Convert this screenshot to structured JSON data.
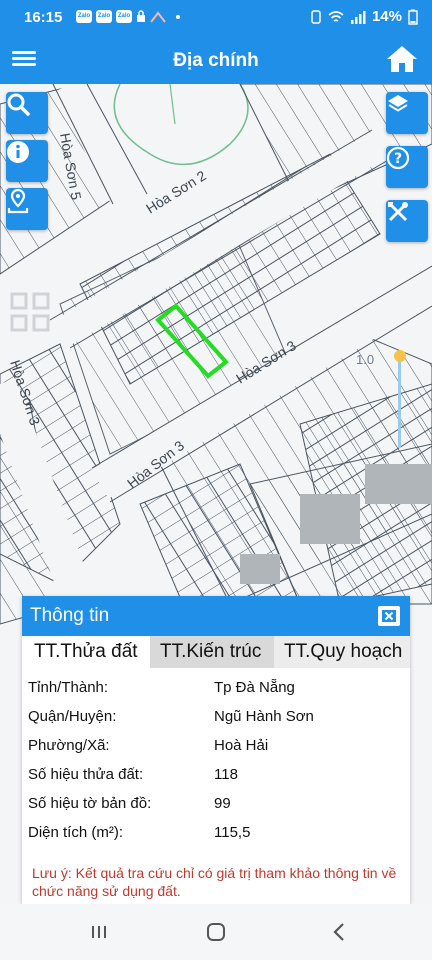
{
  "status_bar": {
    "time": "16:15",
    "notification_icons": [
      "Zalo",
      "Zalo",
      "Zalo"
    ],
    "battery": "14%"
  },
  "header": {
    "title": "Địa chính"
  },
  "map": {
    "street_labels": [
      "Hòa Sơn 5",
      "Hòa Sơn 2",
      "Hòa Sơn 3",
      "Hòa Sơn 3",
      "Hòa Sơn 3"
    ],
    "zoom_level": "1.0",
    "highlight_color": "#22dd22"
  },
  "info_panel": {
    "title": "Thông tin",
    "tabs": [
      "TT.Thửa đất",
      "TT.Kiến trúc",
      "TT.Quy hoạch"
    ],
    "rows": [
      {
        "label": "Tỉnh/Thành:",
        "value": "Tp Đà Nẵng"
      },
      {
        "label": "Quận/Huyện:",
        "value": "Ngũ Hành Sơn"
      },
      {
        "label": "Phường/Xã:",
        "value": "Hoà Hải"
      },
      {
        "label": "Số hiệu thửa đất:",
        "value": "118"
      },
      {
        "label": "Số hiệu tờ bản đồ:",
        "value": "99"
      },
      {
        "label": "Diện tích (m²):",
        "value": "115,5"
      }
    ],
    "note": "Lưu ý: Kết quả tra cứu chỉ có giá trị tham khảo thông tin về chức năng sử dụng đất."
  },
  "colors": {
    "primary": "#1f8fe8",
    "note": "#c0392b",
    "accent": "#f6c34a"
  }
}
